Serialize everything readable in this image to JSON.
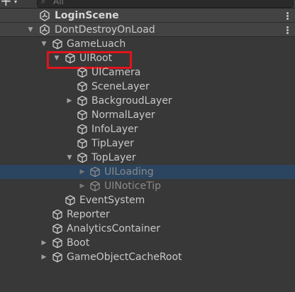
{
  "toolbar": {
    "add_label": "+",
    "add_dropdown": "▾",
    "search_icon": "search-icon",
    "search_placeholder": "All"
  },
  "hierarchy": {
    "login_scene": {
      "label": "LoginScene",
      "icon": "unity-scene-icon",
      "expanded": false
    },
    "dont_destroy": {
      "label": "DontDestroyOnLoad",
      "icon": "unity-scene-icon",
      "expanded": true
    },
    "nodes": {
      "game_luach": {
        "label": "GameLuach",
        "icon": "cube-icon",
        "expanded": true
      },
      "ui_root": {
        "label": "UIRoot",
        "icon": "cube-icon",
        "expanded": true
      },
      "ui_camera": {
        "label": "UICamera",
        "icon": "cube-icon"
      },
      "scene_layer": {
        "label": "SceneLayer",
        "icon": "cube-icon"
      },
      "backgroud_layer": {
        "label": "BackgroudLayer",
        "icon": "cube-icon",
        "expanded": false
      },
      "normal_layer": {
        "label": "NormalLayer",
        "icon": "cube-icon"
      },
      "info_layer": {
        "label": "InfoLayer",
        "icon": "cube-icon"
      },
      "tip_layer": {
        "label": "TipLayer",
        "icon": "cube-icon"
      },
      "top_layer": {
        "label": "TopLayer",
        "icon": "cube-icon",
        "expanded": true
      },
      "ui_loading": {
        "label": "UILoading",
        "icon": "cube-icon",
        "expanded": false,
        "selected": true,
        "active": false
      },
      "ui_notice_tip": {
        "label": "UINoticeTip",
        "icon": "cube-icon",
        "expanded": false,
        "active": false
      },
      "event_system": {
        "label": "EventSystem",
        "icon": "cube-icon"
      },
      "reporter": {
        "label": "Reporter",
        "icon": "cube-icon"
      },
      "analytics_container": {
        "label": "AnalyticsContainer",
        "icon": "cube-icon"
      },
      "boot": {
        "label": "Boot",
        "icon": "cube-icon",
        "expanded": false
      },
      "game_object_cache_root": {
        "label": "GameObjectCacheRoot",
        "icon": "cube-icon",
        "expanded": false
      }
    }
  },
  "colors": {
    "background": "#383838",
    "selection": "#2b4560",
    "highlight_box": "#e0141b",
    "text": "#c8c8c8",
    "text_disabled": "#8a8a8a"
  }
}
